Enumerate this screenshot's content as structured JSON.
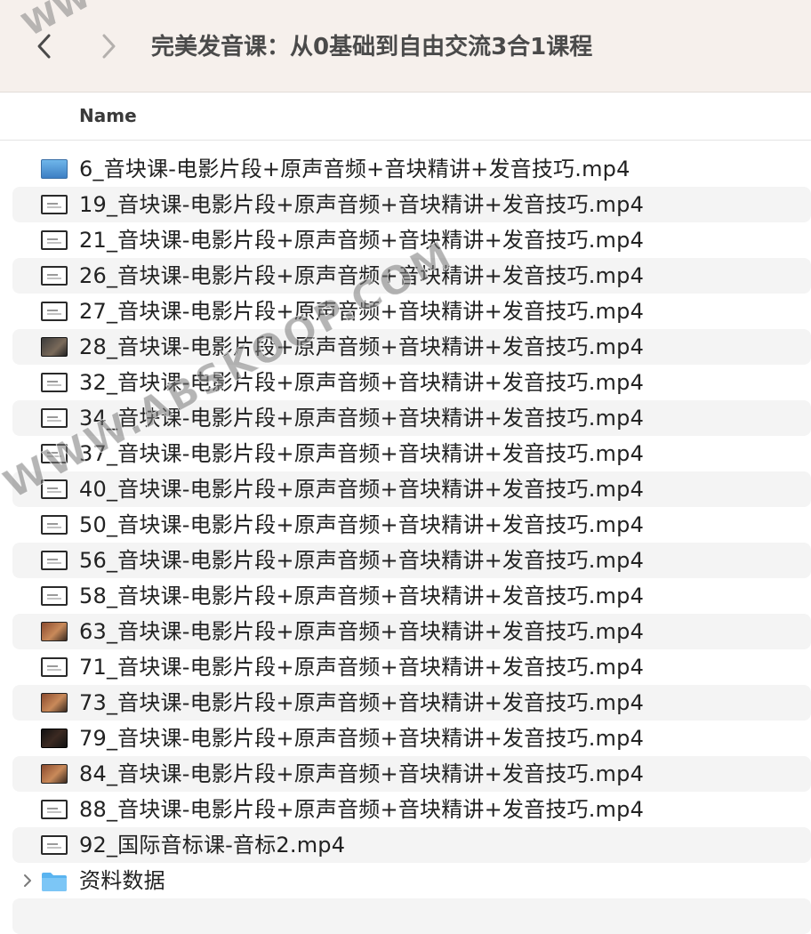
{
  "window": {
    "title": "完美发音课：从0基础到自由交流3合1课程"
  },
  "nav": {
    "back_icon": "chevron-left-icon",
    "forward_icon": "chevron-right-icon"
  },
  "columns": {
    "name": "Name"
  },
  "files": [
    {
      "name": "6_音块课-电影片段+原声音频+音块精讲+发音技巧.mp4",
      "icon": "thumb-blue"
    },
    {
      "name": "19_音块课-电影片段+原声音频+音块精讲+发音技巧.mp4",
      "icon": "video"
    },
    {
      "name": "21_音块课-电影片段+原声音频+音块精讲+发音技巧.mp4",
      "icon": "video"
    },
    {
      "name": "26_音块课-电影片段+原声音频+音块精讲+发音技巧.mp4",
      "icon": "video"
    },
    {
      "name": "27_音块课-电影片段+原声音频+音块精讲+发音技巧.mp4",
      "icon": "video"
    },
    {
      "name": "28_音块课-电影片段+原声音频+音块精讲+发音技巧.mp4",
      "icon": "thumb-dark"
    },
    {
      "name": "32_音块课-电影片段+原声音频+音块精讲+发音技巧.mp4",
      "icon": "video"
    },
    {
      "name": "34_音块课-电影片段+原声音频+音块精讲+发音技巧.mp4",
      "icon": "video"
    },
    {
      "name": "37_音块课-电影片段+原声音频+音块精讲+发音技巧.mp4",
      "icon": "video"
    },
    {
      "name": "40_音块课-电影片段+原声音频+音块精讲+发音技巧.mp4",
      "icon": "video"
    },
    {
      "name": "50_音块课-电影片段+原声音频+音块精讲+发音技巧.mp4",
      "icon": "video"
    },
    {
      "name": "56_音块课-电影片段+原声音频+音块精讲+发音技巧.mp4",
      "icon": "video"
    },
    {
      "name": "58_音块课-电影片段+原声音频+音块精讲+发音技巧.mp4",
      "icon": "video"
    },
    {
      "name": "63_音块课-电影片段+原声音频+音块精讲+发音技巧.mp4",
      "icon": "thumb-warm"
    },
    {
      "name": "71_音块课-电影片段+原声音频+音块精讲+发音技巧.mp4",
      "icon": "video"
    },
    {
      "name": "73_音块课-电影片段+原声音频+音块精讲+发音技巧.mp4",
      "icon": "thumb-warm"
    },
    {
      "name": "79_音块课-电影片段+原声音频+音块精讲+发音技巧.mp4",
      "icon": "thumb-blackred"
    },
    {
      "name": "84_音块课-电影片段+原声音频+音块精讲+发音技巧.mp4",
      "icon": "thumb-warm"
    },
    {
      "name": "88_音块课-电影片段+原声音频+音块精讲+发音技巧.mp4",
      "icon": "video"
    },
    {
      "name": "92_国际音标课-音标2.mp4",
      "icon": "video"
    },
    {
      "name": "资料数据",
      "icon": "folder",
      "expandable": true
    }
  ],
  "watermark": {
    "text": "WWW.ABSKOOP.COM",
    "top_fragment": "WW"
  },
  "colors": {
    "toolbar_bg": "#f6f0ec",
    "row_alt_bg": "#f4f4f4",
    "folder_blue": "#5ab4f0"
  }
}
